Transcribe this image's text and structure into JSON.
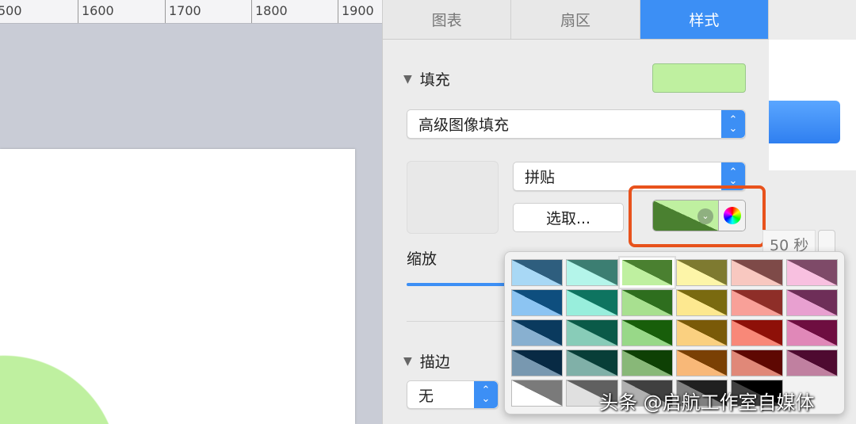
{
  "ruler": {
    "labels": [
      "500",
      "1600",
      "1700",
      "1800",
      "1900"
    ]
  },
  "tabs": [
    "图表",
    "扇区",
    "样式"
  ],
  "fill": {
    "title": "填充",
    "type": "高级图像填充",
    "mode": "拼贴",
    "choose": "选取...",
    "scale_label": "缩放"
  },
  "stroke": {
    "title": "描边",
    "value": "无"
  },
  "duration": "50 秒",
  "colors": {
    "accent": "#3c8ff5",
    "highlight": "#e8521c",
    "fill": "#bff0a0"
  },
  "palette": [
    [
      "#2e5e7e",
      "#a8d8f5"
    ],
    [
      "#3c7e72",
      "#b4f5ea"
    ],
    [
      "#4a8030",
      "#bff0a0"
    ],
    [
      "#7e7a30",
      "#fdf5a8"
    ],
    [
      "#7e4a48",
      "#f8c8c0"
    ],
    [
      "#7e4a68",
      "#f8c0e0"
    ],
    [
      "#0e4e7e",
      "#8cc4f2"
    ],
    [
      "#0e7460",
      "#98eedc"
    ],
    [
      "#2e6e1e",
      "#a8e090"
    ],
    [
      "#7a6a10",
      "#fde890"
    ],
    [
      "#8e2e28",
      "#f8a098"
    ],
    [
      "#6e2e58",
      "#e8a0d0"
    ],
    [
      "#0a3a5e",
      "#88b0d0"
    ],
    [
      "#0a5a48",
      "#88ccb8"
    ],
    [
      "#185e0a",
      "#98d888"
    ],
    [
      "#7a5a08",
      "#fad080"
    ],
    [
      "#8e1008",
      "#f88878"
    ],
    [
      "#6e0e40",
      "#e088b8"
    ],
    [
      "#082a44",
      "#7898b0"
    ],
    [
      "#083e38",
      "#80b0a8"
    ],
    [
      "#0e4004",
      "#88b878"
    ],
    [
      "#7a4004",
      "#f8b878"
    ],
    [
      "#5e0802",
      "#e08878"
    ],
    [
      "#4e0a30",
      "#c080a0"
    ],
    [
      "#7a7a7a",
      "#ffffff"
    ],
    [
      "#606060",
      "#e0e0e0"
    ],
    [
      "#404040",
      "#b0b0b0"
    ],
    [
      "#202020",
      "#808080"
    ],
    [
      "#000000",
      "#404040"
    ]
  ],
  "watermark": "头条 @启航工作室自媒体"
}
